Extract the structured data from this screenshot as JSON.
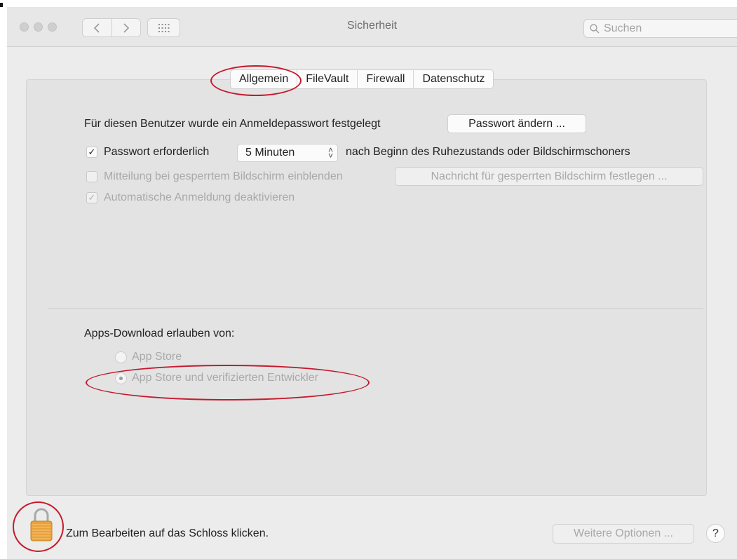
{
  "window": {
    "title": "Sicherheit"
  },
  "search": {
    "placeholder": "Suchen"
  },
  "tabs": [
    {
      "label": "Allgemein",
      "selected": true
    },
    {
      "label": "FileVault"
    },
    {
      "label": "Firewall"
    },
    {
      "label": "Datenschutz"
    }
  ],
  "general": {
    "password_info": "Für diesen Benutzer wurde ein Anmeldepasswort festgelegt",
    "change_password_button": "Passwort ändern ...",
    "require_password_label": "Passwort erforderlich",
    "require_password_checked": true,
    "delay_select_value": "5 Minuten",
    "after_sleep_text": "nach Beginn des Ruhezustands oder Bildschirmschoners",
    "show_message_label": "Mitteilung bei gesperrtem Bildschirm einblenden",
    "show_message_checked": false,
    "set_message_button": "Nachricht für gesperrten Bildschirm festlegen ...",
    "disable_autologin_label": "Automatische Anmeldung deaktivieren",
    "disable_autologin_checked": true
  },
  "apps_download": {
    "heading": "Apps-Download erlauben von:",
    "options": [
      {
        "label": "App Store",
        "selected": false
      },
      {
        "label": "App Store und verifizierten Entwickler",
        "selected": true
      }
    ]
  },
  "footer": {
    "lock_text": "Zum Bearbeiten auf das Schloss klicken.",
    "more_options_button": "Weitere Optionen ...",
    "help_button": "?"
  },
  "icons": {
    "search": "magnifier-icon",
    "lock": "padlock-icon",
    "grid": "grid-dots-icon",
    "back": "chevron-left-icon",
    "forward": "chevron-right-icon"
  },
  "colors": {
    "annotation": "#c5192d",
    "lock_body": "#e9a13b",
    "panel": "#e3e3e3"
  }
}
